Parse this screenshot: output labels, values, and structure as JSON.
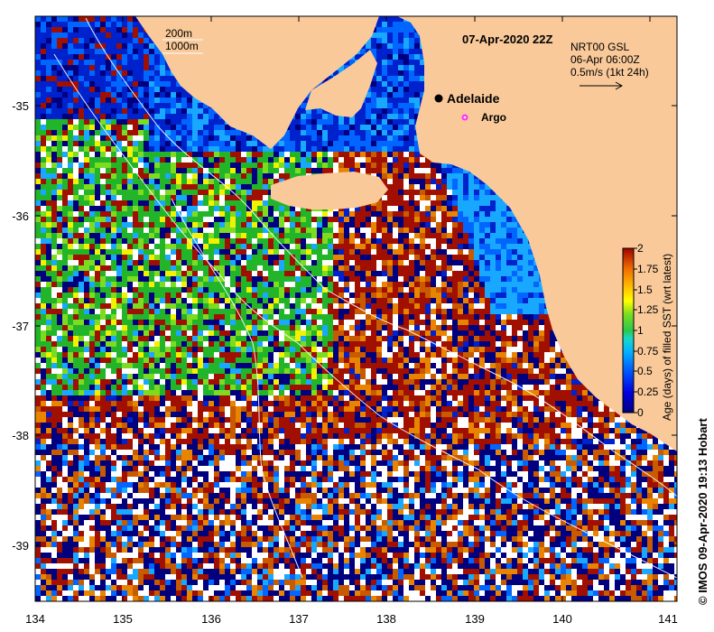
{
  "map": {
    "title": "07-Apr-2020 22Z",
    "lon_ticks": [
      "134",
      "135",
      "136",
      "137",
      "138",
      "139",
      "140",
      "141"
    ],
    "lat_ticks": [
      "-35",
      "-36",
      "-37",
      "-38",
      "-39"
    ],
    "isobath_legend": {
      "line1": "200m",
      "line2": "1000m"
    },
    "product": {
      "line1": "NRT00 GSL",
      "line2": "06-Apr 06:00Z",
      "line3": "0.5m/s (1kt 24h)"
    },
    "places": {
      "city": "Adelaide",
      "float": "Argo"
    },
    "colorbar": {
      "label": "Age (days) of filled SST (wrt latest)",
      "ticks": [
        "2",
        "1.75",
        "1.5",
        "1.25",
        "1",
        "0.75",
        "0.5",
        "0.25",
        "0"
      ]
    },
    "credit": "© IMOS 09-Apr-2020 19:13 Hobart",
    "colors": {
      "land": "#f9c99a",
      "age_0": "#00007f",
      "age_0_5": "#00a0ff",
      "age_1": "#22c12a",
      "age_1_5": "#ee8a00",
      "age_2": "#a50f00",
      "marker_argo": "#ff33ff"
    }
  }
}
